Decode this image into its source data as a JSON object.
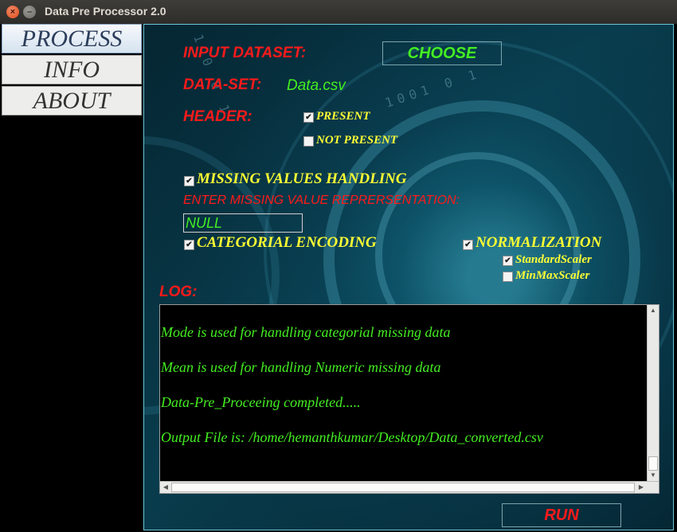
{
  "window": {
    "title": "Data Pre Processor 2.0"
  },
  "tabs": [
    "PROCESS",
    "INFO",
    "ABOUT"
  ],
  "input": {
    "label": "INPUT DATASET:",
    "choose_button": "CHOOSE"
  },
  "dataset": {
    "label": "DATA-SET:",
    "value": "Data.csv"
  },
  "header": {
    "label": "HEADER:",
    "options": [
      {
        "label": "PRESENT",
        "checked": true
      },
      {
        "label": "NOT PRESENT",
        "checked": false
      }
    ]
  },
  "missing": {
    "label": "MISSING VALUES HANDLING",
    "checked": true,
    "prompt": "ENTER MISSING VALUE REPRERSENTATION:",
    "value": "NULL"
  },
  "categorical": {
    "label": "CATEGORIAL ENCODING",
    "checked": true
  },
  "normalization": {
    "label": "NORMALIZATION",
    "checked": true,
    "options": [
      {
        "label": "StandardScaler",
        "checked": true
      },
      {
        "label": "MinMaxScaler",
        "checked": false
      }
    ]
  },
  "log": {
    "label": "LOG:",
    "lines": [
      "Mode is used for handling categorial missing data",
      "Mean is used for handling Numeric missing data",
      "Data-Pre_Proceeing completed.....",
      "Output File is:  /home/hemanthkumar/Desktop/Data_converted.csv"
    ]
  },
  "run_button": "RUN",
  "colors": {
    "label_red": "#ff1a1a",
    "text_yellow": "#ffff33",
    "text_green": "#44ee22"
  }
}
